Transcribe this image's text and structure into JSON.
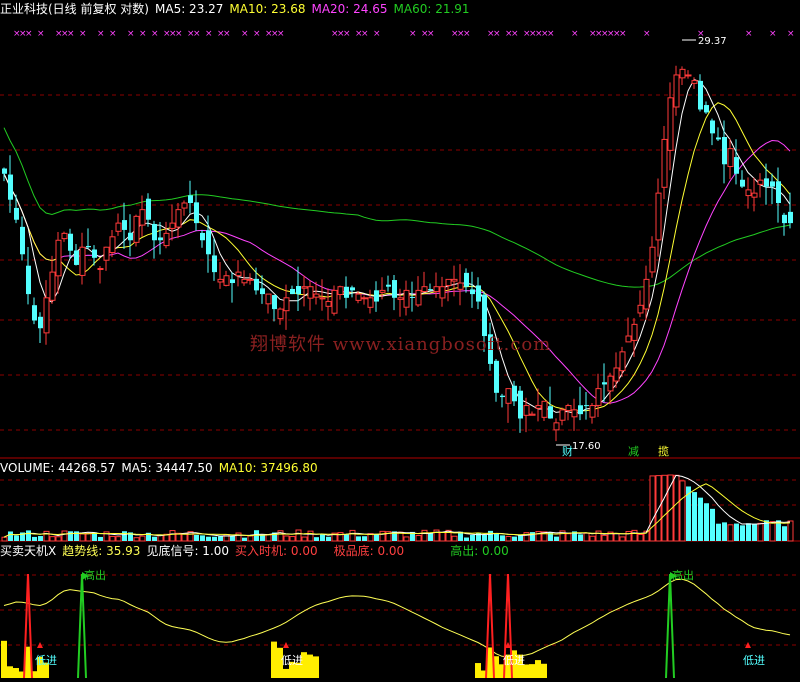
{
  "price_header": {
    "title": "正业科技(日线 前复权 对数)",
    "ma5": "MA5: 23.27",
    "ma10": "MA10: 23.68",
    "ma20": "MA20: 24.65",
    "ma60": "MA60: 21.91"
  },
  "volume_header": {
    "volume": "VOLUME: 44268.57",
    "ma5": "MA5: 34447.50",
    "ma10": "MA10: 37496.80"
  },
  "indicator_header": {
    "name": "买卖天机X",
    "trend": "趋势线: 35.93",
    "bottom": "见底信号: 1.00",
    "buy": "买入时机: 0.00",
    "extreme": "极品底: 0.00",
    "high": "高出: 0.00"
  },
  "watermark": "翔博软件 www.xiangbosoft.com",
  "price_annotations": {
    "high": "29.37",
    "low": "17.60",
    "markers": [
      "财",
      "减",
      "揽"
    ]
  },
  "indicator_labels": {
    "high_out": "高出",
    "low_in": "低进"
  },
  "colors": {
    "candle_up": "#ff3a3a",
    "candle_down": "#54ffff",
    "ma5": "#ffffff",
    "ma10": "#ffff33",
    "ma20": "#ff44ff",
    "ma60": "#22cc22",
    "grid": "#8b0000",
    "trend": "#ffff55"
  },
  "chart_data": [
    {
      "type": "candlestick",
      "title": "正业科技(日线 前复权 对数)",
      "y_high_label": 29.37,
      "y_low_label": 17.6,
      "x": [
        1,
        2,
        3,
        4,
        5,
        6,
        7,
        8,
        9,
        10,
        11,
        12,
        13,
        14,
        15,
        16,
        17,
        18,
        19,
        20,
        21,
        22,
        23,
        24,
        25,
        26,
        27,
        28,
        29,
        30,
        31,
        32,
        33,
        34,
        35,
        36,
        37,
        38,
        39,
        40,
        41,
        42,
        43,
        44,
        45,
        46,
        47,
        48,
        49,
        50,
        51,
        52,
        53,
        54,
        55,
        56,
        57,
        58,
        59,
        60,
        61,
        62,
        63,
        64,
        65,
        66,
        67,
        68,
        69,
        70,
        71,
        72,
        73,
        74,
        75,
        76,
        77,
        78,
        79,
        80,
        81,
        82,
        83,
        84,
        85,
        86,
        87,
        88,
        89,
        90,
        91,
        92,
        93,
        94,
        95,
        96,
        97,
        98,
        99,
        100,
        101,
        102,
        103,
        104,
        105,
        106,
        107,
        108,
        109,
        110,
        111,
        112,
        113,
        114,
        115,
        116,
        117,
        118,
        119,
        120,
        121,
        122,
        123,
        124,
        125,
        126,
        127,
        128,
        129,
        130,
        131,
        132
      ],
      "close": [
        24.8,
        24.0,
        23.4,
        22.4,
        21.3,
        20.6,
        20.4,
        21.2,
        21.9,
        22.8,
        23.0,
        22.5,
        22.1,
        22.6,
        22.6,
        22.3,
        22.0,
        22.6,
        22.9,
        23.3,
        23.1,
        22.8,
        23.5,
        23.7,
        23.4,
        22.8,
        22.8,
        23.0,
        23.3,
        23.7,
        23.9,
        23.9,
        23.3,
        22.8,
        22.4,
        21.9,
        21.7,
        21.8,
        21.6,
        21.9,
        21.7,
        21.7,
        21.4,
        21.3,
        21.3,
        20.9,
        20.9,
        21.2,
        21.3,
        21.3,
        21.5,
        21.5,
        21.3,
        21.2,
        21.1,
        21.4,
        21.5,
        21.2,
        21.4,
        21.3,
        21.2,
        21.2,
        21.1,
        21.4,
        21.5,
        21.2,
        21.2,
        21.4,
        21.2,
        21.4,
        21.5,
        21.4,
        21.5,
        21.5,
        21.7,
        21.7,
        21.6,
        21.5,
        21.3,
        21.1,
        20.2,
        19.5,
        18.8,
        18.7,
        18.9,
        18.6,
        18.2,
        18.5,
        18.3,
        18.5,
        18.6,
        18.2,
        18.1,
        18.4,
        18.5,
        18.4,
        18.3,
        18.5,
        18.5,
        18.9,
        19.0,
        19.2,
        19.4,
        19.8,
        20.2,
        20.5,
        21.0,
        21.7,
        22.6,
        24.2,
        25.9,
        27.3,
        28.1,
        28.3,
        28.1,
        27.9,
        26.9,
        26.8,
        26.1,
        25.9,
        25.1,
        25.6,
        24.8,
        24.4,
        24.3,
        24.2,
        24.6,
        24.4,
        24.4,
        23.9,
        23.3,
        23.3
      ],
      "series": [
        {
          "name": "MA5",
          "value": 23.27
        },
        {
          "name": "MA10",
          "value": 23.68
        },
        {
          "name": "MA20",
          "value": 24.65
        },
        {
          "name": "MA60",
          "value": 21.91
        }
      ]
    },
    {
      "type": "bar",
      "title": "VOLUME",
      "series": [
        {
          "name": "VOLUME",
          "value": 44268.57
        },
        {
          "name": "MA5",
          "value": 34447.5
        },
        {
          "name": "MA10",
          "value": 37496.8
        }
      ]
    },
    {
      "type": "line",
      "title": "买卖天机X",
      "series": [
        {
          "name": "趋势线",
          "value": 35.93
        },
        {
          "name": "见底信号",
          "value": 1.0
        },
        {
          "name": "买入时机",
          "value": 0.0
        },
        {
          "name": "极品底",
          "value": 0.0
        },
        {
          "name": "高出",
          "value": 0.0
        }
      ]
    }
  ]
}
